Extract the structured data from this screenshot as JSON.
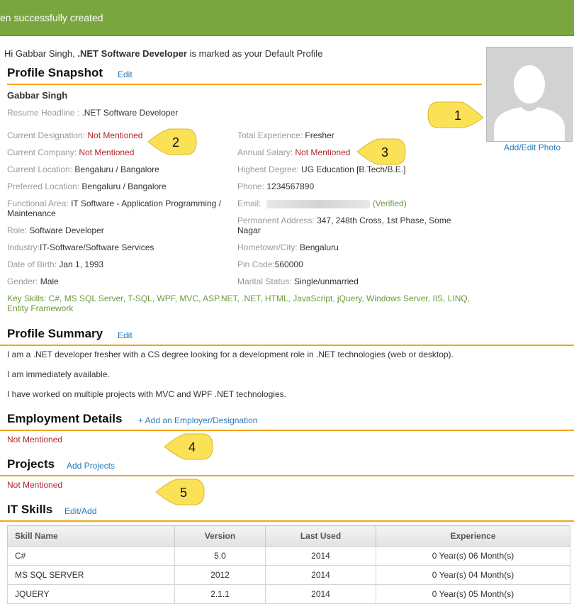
{
  "banner": {
    "message": "en successfully created",
    "color": "#7aa640"
  },
  "greeting": {
    "prefix": "Hi Gabbar Singh, ",
    "profile": ".NET Software Developer",
    "suffix": " is marked as your Default Profile"
  },
  "snapshot": {
    "title": "Profile Snapshot",
    "edit": "Edit",
    "name": "Gabbar Singh",
    "headline_label": "Resume Headline : ",
    "headline_value": ".NET Software Developer",
    "left": [
      {
        "label": "Current Designation: ",
        "value": "Not Mentioned",
        "nm": true
      },
      {
        "label": "Current Company: ",
        "value": "Not Mentioned",
        "nm": true
      },
      {
        "label": "Current Location: ",
        "value": "Bengaluru / Bangalore"
      },
      {
        "label": "Preferred Location: ",
        "value": "Bengaluru / Bangalore"
      },
      {
        "label": "Functional Area: ",
        "value": "IT Software - Application Programming / Maintenance"
      },
      {
        "label": "Role: ",
        "value": "Software Developer"
      },
      {
        "label": "Industry:",
        "value": "IT-Software/Software Services"
      },
      {
        "label": "Date of Birth: ",
        "value": "Jan 1, 1993"
      },
      {
        "label": "Gender: ",
        "value": "Male"
      }
    ],
    "right": [
      {
        "label": "Total Experience: ",
        "value": "Fresher"
      },
      {
        "label": "Annual Salary: ",
        "value": "Not Mentioned",
        "nm": true
      },
      {
        "label": "Highest Degree: ",
        "value": "UG Education [B.Tech/B.E.]"
      },
      {
        "label": "Phone: ",
        "value": "1234567890"
      },
      {
        "label": "Email: ",
        "value": "",
        "verified": "(Verified)"
      },
      {
        "label": "Permanent Address: ",
        "value": "347, 248th Cross, 1st Phase, Some Nagar"
      },
      {
        "label": "Hometown/City: ",
        "value": "Bengaluru"
      },
      {
        "label": "Pin Code:",
        "value": "560000"
      },
      {
        "label": "Marital Status: ",
        "value": "Single/unmarried"
      }
    ],
    "key_skills": "Key Skills: C#, MS SQL Server, T-SQL, WPF, MVC, ASP.NET, .NET, HTML, JavaScript, jQuery, Windows Server, IIS, LINQ, Entity Framework"
  },
  "photo": {
    "link": "Add/Edit Photo"
  },
  "summary": {
    "title": "Profile Summary",
    "edit": "Edit",
    "lines": [
      "I am a .NET developer fresher with a CS degree looking for a development role in .NET technologies (web or desktop).",
      "I am immediately available.",
      "I have worked on multiple projects with MVC and WPF .NET technologies."
    ]
  },
  "employment": {
    "title": "Employment Details",
    "link": "+ Add an Employer/Designation",
    "value": "Not Mentioned"
  },
  "projects": {
    "title": "Projects",
    "link": "Add Projects",
    "value": "Not Mentioned"
  },
  "it_skills": {
    "title": "IT Skills",
    "link": "Edit/Add",
    "headers": [
      "Skill Name",
      "Version",
      "Last Used",
      "Experience"
    ],
    "rows": [
      [
        "C#",
        "5.0",
        "2014",
        "0 Year(s) 06 Month(s)"
      ],
      [
        "MS SQL SERVER",
        "2012",
        "2014",
        "0 Year(s) 04 Month(s)"
      ],
      [
        "JQUERY",
        "2.1.1",
        "2014",
        "0 Year(s) 05 Month(s)"
      ]
    ]
  },
  "callouts": [
    "1",
    "2",
    "3",
    "4",
    "5"
  ],
  "colors": {
    "accent_rule": "#f3a41b",
    "link": "#2a7ab8",
    "not_mentioned": "#b2262c",
    "green": "#6a9a3a",
    "callout": "#fbe156"
  }
}
